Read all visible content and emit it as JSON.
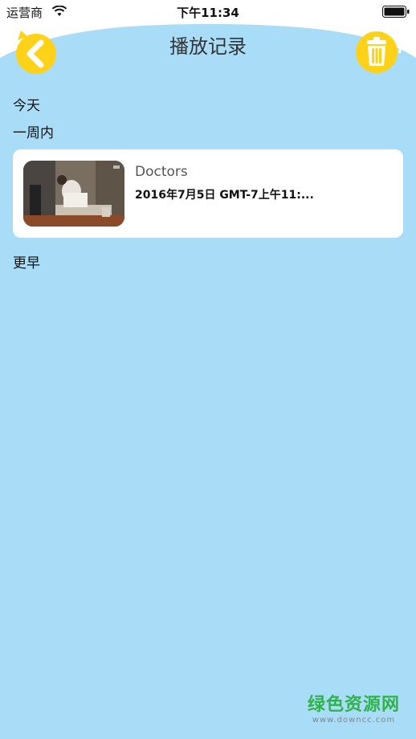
{
  "status_bar": {
    "carrier": "运营商",
    "time": "下午11:34",
    "icons": [
      "wifi-icon",
      "battery-icon"
    ]
  },
  "header": {
    "title": "播放记录",
    "back_icon": "chevron-left-icon",
    "trash_icon": "trash-icon"
  },
  "sections": {
    "today": "今天",
    "week": "一周内",
    "earlier": "更早"
  },
  "records": [
    {
      "title": "Doctors",
      "date": "2016年7月5日 GMT-7上午11:..."
    }
  ],
  "watermark": {
    "cn": "绿色资源网",
    "en": "www.downcc.com"
  },
  "colors": {
    "background": "#a9dcf7",
    "accent_yellow": "#ffd21a",
    "card": "#ffffff"
  }
}
